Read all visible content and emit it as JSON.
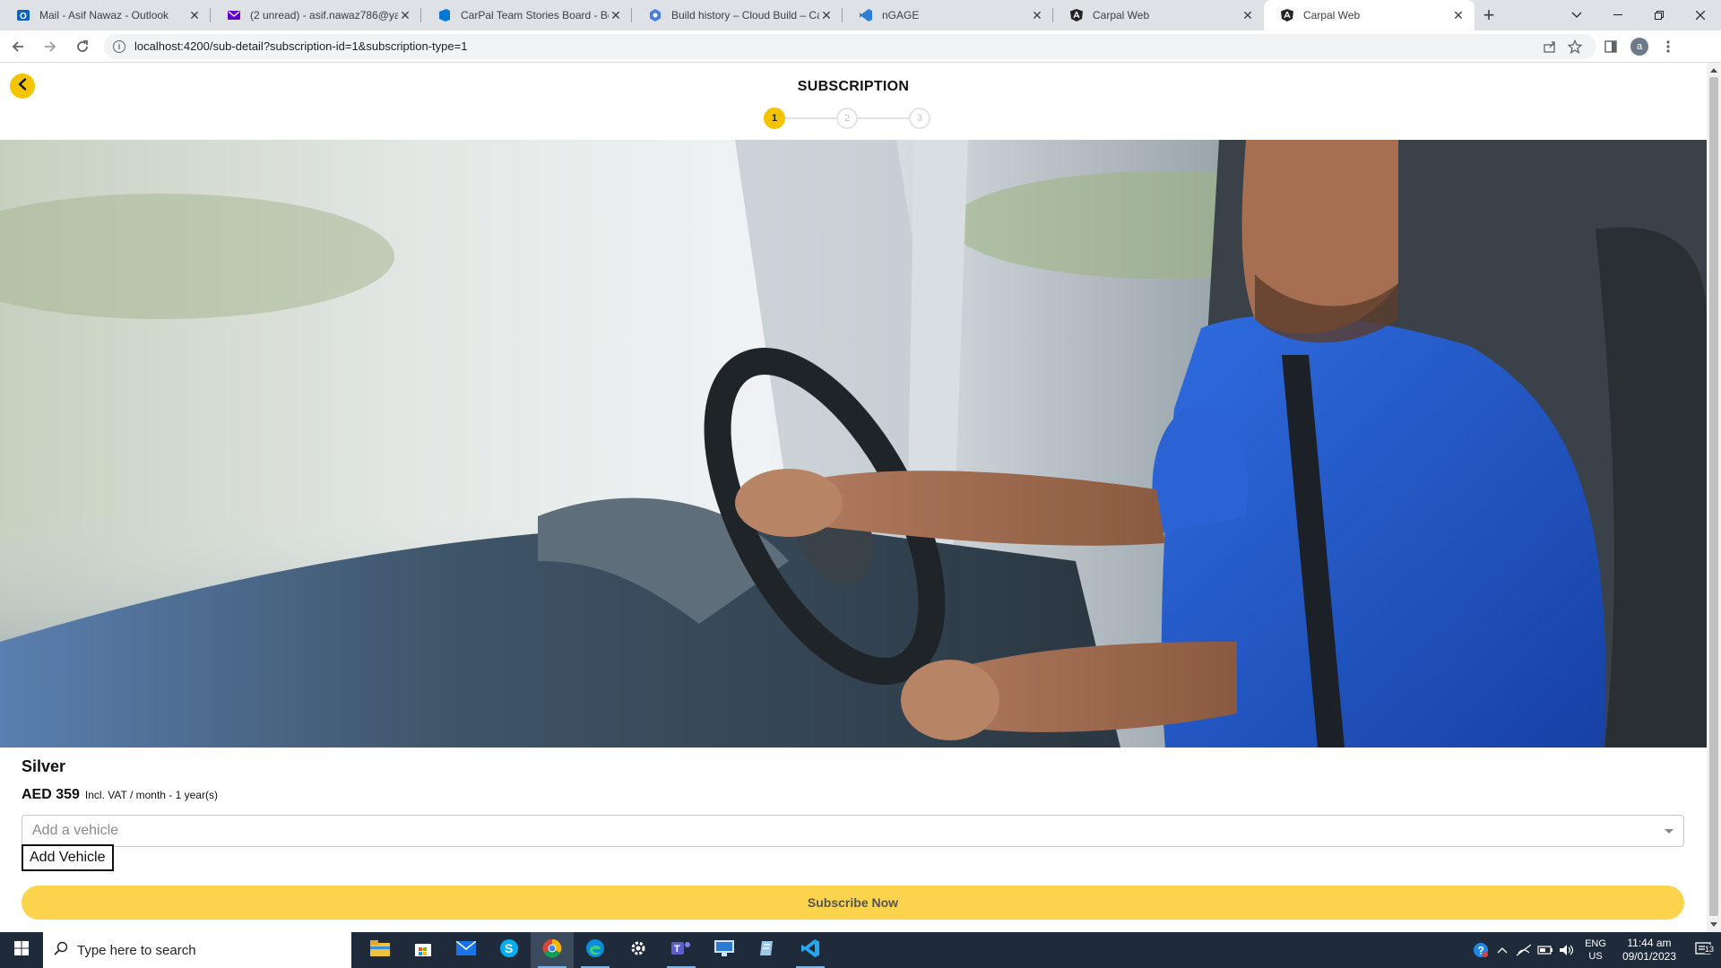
{
  "browser": {
    "tabs": [
      {
        "title": "Mail - Asif Nawaz - Outlook",
        "icon": "outlook-icon",
        "active": false
      },
      {
        "title": "(2 unread) - asif.nawaz786@yahoo",
        "icon": "yahoo-mail-icon",
        "active": false
      },
      {
        "title": "CarPal Team Stories Board - Boa",
        "icon": "azure-devops-icon",
        "active": false
      },
      {
        "title": "Build history – Cloud Build – Car",
        "icon": "cloud-build-icon",
        "active": false
      },
      {
        "title": "nGAGE",
        "icon": "vscode-icon",
        "active": false
      },
      {
        "title": "Carpal Web",
        "icon": "angular-icon",
        "active": false
      },
      {
        "title": "Carpal Web",
        "icon": "angular-icon",
        "active": true
      }
    ],
    "url": "localhost:4200/sub-detail?subscription-id=1&subscription-type=1",
    "profile_initial": "a"
  },
  "page": {
    "title": "SUBSCRIPTION",
    "steps": [
      "1",
      "2",
      "3"
    ],
    "active_step": 1,
    "plan": {
      "name": "Silver",
      "price": "AED 359",
      "price_note": "Incl. VAT / month - 1 year(s)"
    },
    "vehicle_select": {
      "placeholder": "Add a vehicle"
    },
    "add_vehicle_label": "Add Vehicle",
    "subscribe_label": "Subscribe Now",
    "hero_alt": "driver-in-van-photo"
  },
  "taskbar": {
    "search_placeholder": "Type here to search",
    "language": "ENG",
    "region": "US",
    "time": "11:44 am",
    "date": "09/01/2023",
    "notification_count": "13"
  },
  "colors": {
    "accent": "#f5c400",
    "subscribe_button": "#fbd34d",
    "shirt_blue": "#1f55c8"
  }
}
